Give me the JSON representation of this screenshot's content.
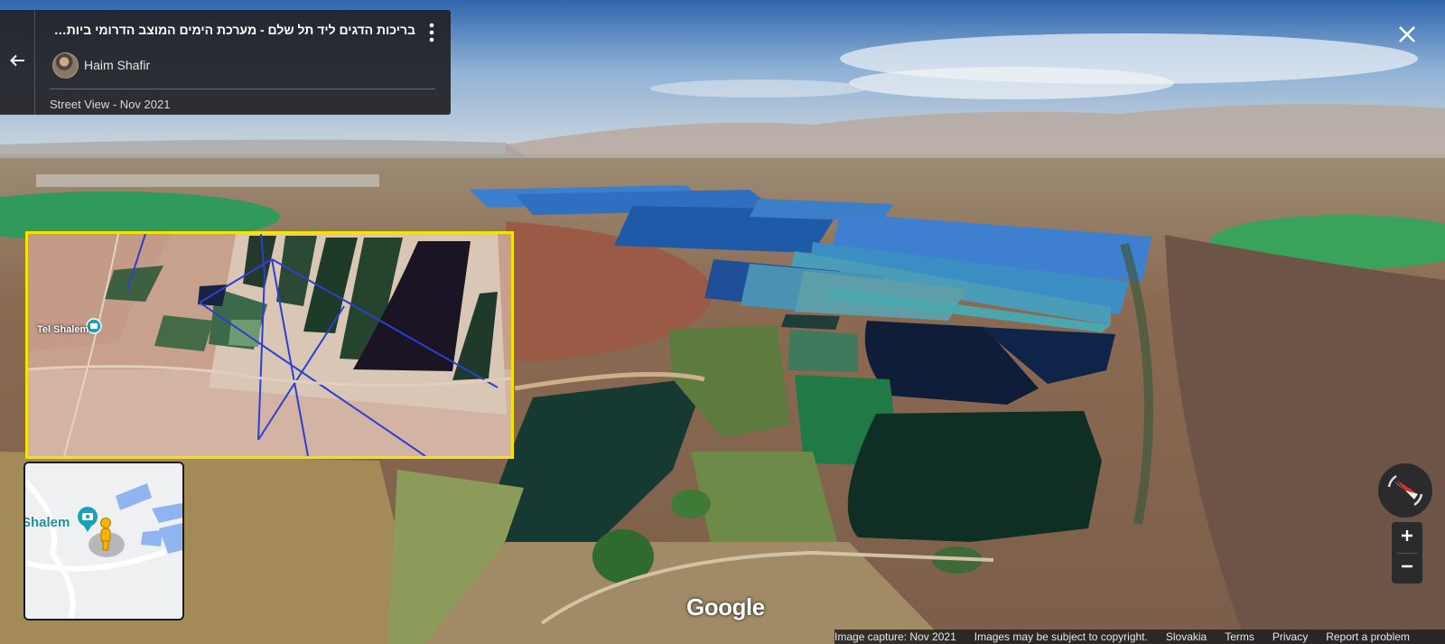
{
  "info_card": {
    "title": "בריכות הדגים ליד תל שלם - מערכת הימים המוצב הדרומי ביותר לכיוון בקעת הירדן מבקעת בית שאן",
    "author": "Haim Shafir",
    "capture": "Street View - Nov 2021"
  },
  "overlay": {
    "place_label": "Tel Shalem"
  },
  "mini_map": {
    "place_label": "Shalem"
  },
  "logo": {
    "text": "Google"
  },
  "footer": {
    "image_capture": "Image capture: Nov 2021",
    "copyright": "Images may be subject to copyright.",
    "country": "Slovakia",
    "terms": "Terms",
    "privacy": "Privacy",
    "report": "Report a problem"
  },
  "icons": {
    "back": "arrow-left-icon",
    "more": "more-vert-icon",
    "close": "close-icon",
    "compass": "compass-icon",
    "zoom_in": "plus-icon",
    "zoom_out": "minus-icon",
    "pegman": "pegman-icon",
    "photo_pin": "camera-pin-icon"
  },
  "colors": {
    "highlight": "#f4e400",
    "card_bg": "#222226",
    "compass_needle": "#d93025"
  }
}
